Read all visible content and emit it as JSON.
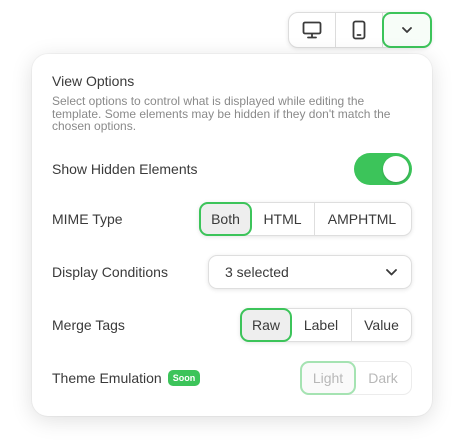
{
  "device_toolbar": {
    "buttons": [
      {
        "icon": "desktop-icon",
        "active": false
      },
      {
        "icon": "mobile-icon",
        "active": false
      },
      {
        "icon": "chevron-down-icon",
        "active": true
      }
    ]
  },
  "panel": {
    "title": "View Options",
    "description": "Select options to control what is displayed while editing the template. Some elements may be hidden if they don't match the chosen options.",
    "show_hidden": {
      "label": "Show Hidden Elements",
      "enabled": true
    },
    "mime_type": {
      "label": "MIME Type",
      "options": [
        "Both",
        "HTML",
        "AMPHTML"
      ],
      "selected": "Both"
    },
    "display_conditions": {
      "label": "Display Conditions",
      "value": "3 selected"
    },
    "merge_tags": {
      "label": "Merge Tags",
      "options": [
        "Raw",
        "Label",
        "Value"
      ],
      "selected": "Raw"
    },
    "theme_emulation": {
      "label": "Theme Emulation",
      "badge": "Soon",
      "options": [
        "Light",
        "Dark"
      ],
      "selected": "Light",
      "disabled": true
    }
  },
  "colors": {
    "accent": "#3cc45a",
    "text": "#3a3a3a",
    "muted": "#8a8a8a"
  }
}
